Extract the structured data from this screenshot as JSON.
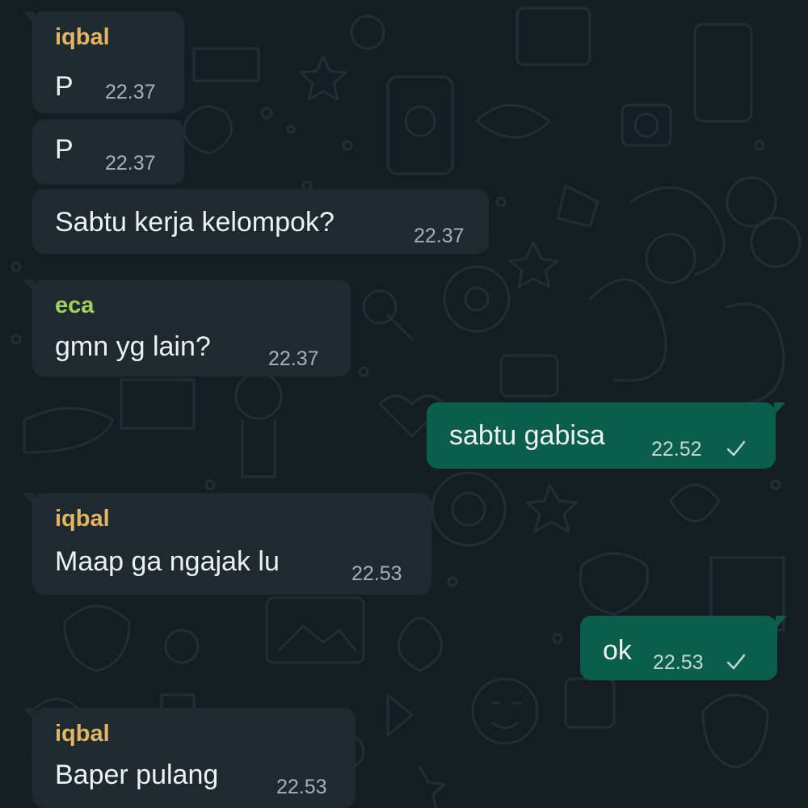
{
  "colors": {
    "incoming_bubble": "#1e2a30",
    "outgoing_bubble": "#0b5e4c",
    "sender_iqbal": "#e3b563",
    "sender_eca": "#a3d15e",
    "background": "#141d21"
  },
  "messages": [
    {
      "sender": "iqbal",
      "text": "P",
      "time": "22.37"
    },
    {
      "text": "P",
      "time": "22.37"
    },
    {
      "text": "Sabtu kerja kelompok?",
      "time": "22.37"
    },
    {
      "sender": "eca",
      "text": "gmn yg lain?",
      "time": "22.37"
    },
    {
      "text": "sabtu gabisa",
      "time": "22.52",
      "status_icon": "single-check-icon"
    },
    {
      "sender": "iqbal",
      "text": "Maap ga ngajak lu",
      "time": "22.53"
    },
    {
      "text": "ok",
      "time": "22.53",
      "status_icon": "single-check-icon"
    },
    {
      "sender": "iqbal",
      "text": "Baper pulang",
      "time": "22.53"
    }
  ]
}
